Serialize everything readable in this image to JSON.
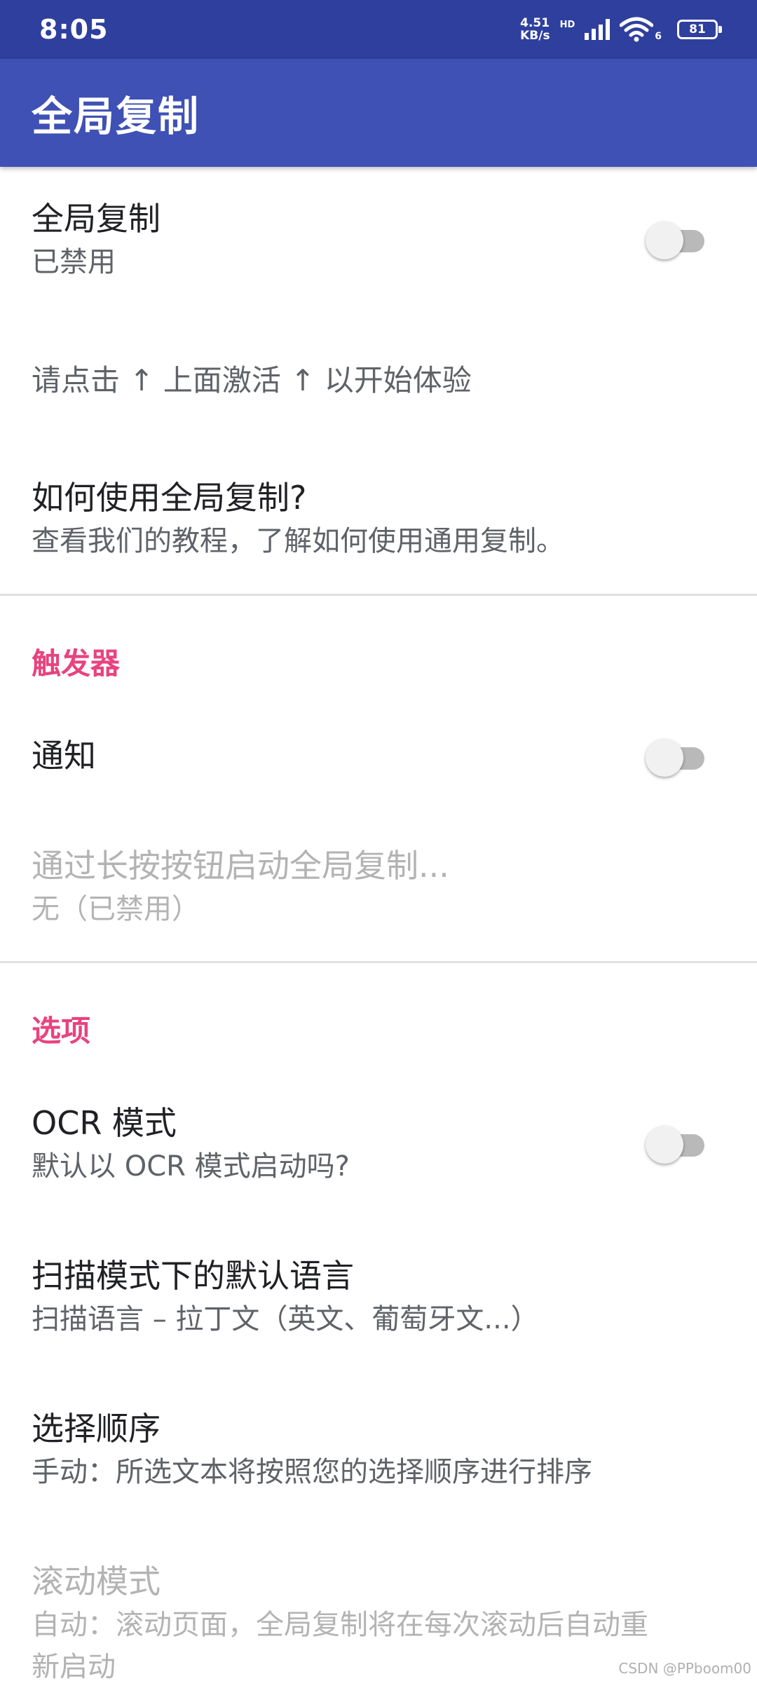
{
  "status_bar": {
    "time": "8:05",
    "net_speed_value": "4.51",
    "net_speed_unit": "KB/s",
    "hd": "HD",
    "wifi_sub": "6",
    "battery": "81"
  },
  "app_bar": {
    "title": "全局复制"
  },
  "settings": {
    "global_copy": {
      "title": "全局复制",
      "subtitle": "已禁用",
      "enabled": false
    },
    "hint": "请点击 ↑ 上面激活 ↑ 以开始体验",
    "how_to": {
      "title": "如何使用全局复制?",
      "subtitle": "查看我们的教程，了解如何使用通用复制。"
    },
    "triggers": {
      "header": "触发器",
      "notification": {
        "title": "通知",
        "enabled": false
      },
      "long_press": {
        "title": "通过长按按钮启动全局复制...",
        "subtitle": "无（已禁用）"
      }
    },
    "options": {
      "header": "选项",
      "ocr_mode": {
        "title": "OCR 模式",
        "subtitle": "默认以 OCR 模式启动吗?",
        "enabled": false
      },
      "default_language": {
        "title": "扫描模式下的默认语言",
        "subtitle": "扫描语言 – 拉丁文（英文、葡萄牙文...）"
      },
      "selection_order": {
        "title": "选择顺序",
        "subtitle": "手动：所选文本将按照您的选择顺序进行排序"
      },
      "scroll_mode": {
        "title": "滚动模式",
        "subtitle_line1": "自动：滚动页面，全局复制将在每次滚动后自动重",
        "subtitle_line2": "新启动"
      }
    }
  },
  "colors": {
    "status_bar": "#2f3f9e",
    "app_bar": "#3f51b5",
    "accent": "#e8437f"
  },
  "watermark": "CSDN @PPboom00"
}
